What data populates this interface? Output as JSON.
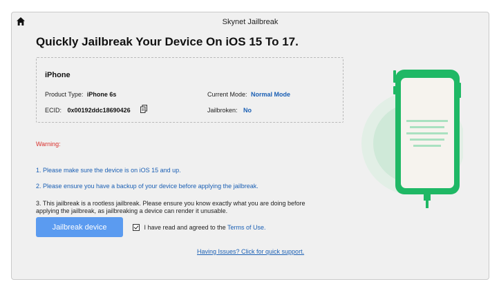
{
  "window": {
    "title": "Skynet Jailbreak"
  },
  "main": {
    "heading": "Quickly Jailbreak Your Device On iOS 15 To 17."
  },
  "device": {
    "name": "iPhone",
    "product_type_label": "Product Type:",
    "product_type_value": "iPhone 6s",
    "current_mode_label": "Current Mode:",
    "current_mode_value": "Normal Mode",
    "ecid_label": "ECID:",
    "ecid_value": "0x00192ddc18690426",
    "jailbroken_label": "Jailbroken:",
    "jailbroken_value": "No"
  },
  "warnings": {
    "title": "Warning:",
    "note1": "1. Please make sure the device is on iOS 15 and up.",
    "note2": "2. Please ensure you have a backup of your device before applying the jailbreak.",
    "note3": "3. This jailbreak is a rootless jailbreak. Please ensure you know exactly what you are doing before applying the jailbreak, as jailbreaking a device can render it unusable."
  },
  "actions": {
    "jailbreak_label": "Jailbreak device",
    "agree_text": "I have read and agreed to the",
    "terms_link": "Terms of Use.",
    "agree_checked": true,
    "support_link": "Having Issues? Click for quick support."
  },
  "colors": {
    "accent_blue": "#1a5fb4",
    "button_blue": "#5b9bf0",
    "warning_red": "#d9302c",
    "phone_green": "#1fb865"
  },
  "icons": {
    "home": "home-icon",
    "copy": "copy-icon"
  }
}
